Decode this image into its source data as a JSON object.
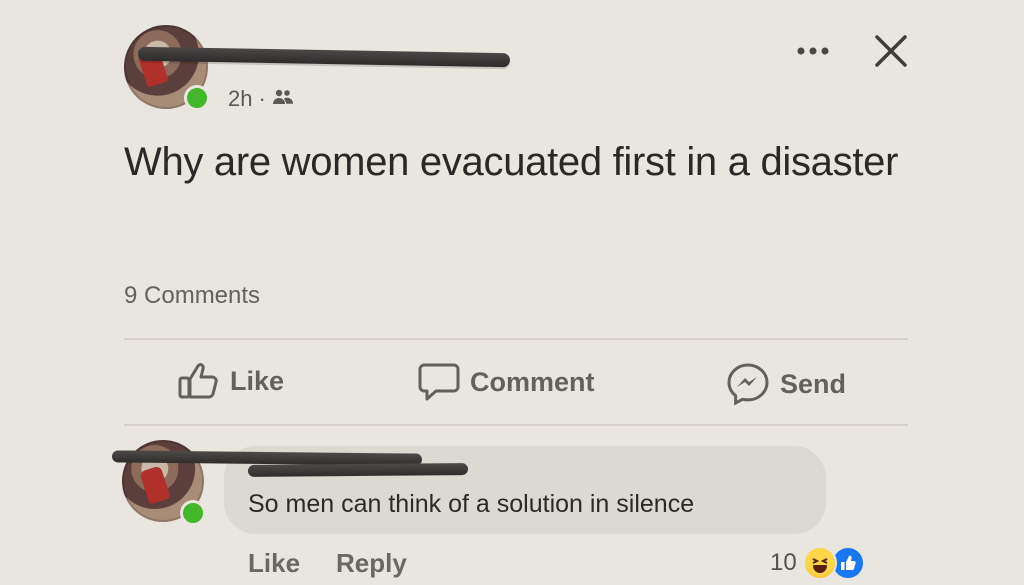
{
  "post": {
    "time": "2h",
    "separator": "·",
    "audience_icon": "friends-icon",
    "text": "Why are women evacuated first in a disaster",
    "comments_count": "9 Comments",
    "menu_icon": "more-icon",
    "close_icon": "close-icon"
  },
  "actions": {
    "like": "Like",
    "comment": "Comment",
    "send": "Send"
  },
  "comment": {
    "text": "So men can think of a solution in silence",
    "like": "Like",
    "reply": "Reply",
    "reaction_count": "10",
    "reactions": [
      "haha-emoji-icon",
      "like-emoji-icon"
    ]
  },
  "colors": {
    "background": "#e9e5df",
    "online": "#42b72a",
    "like_blue": "#1877f2"
  }
}
